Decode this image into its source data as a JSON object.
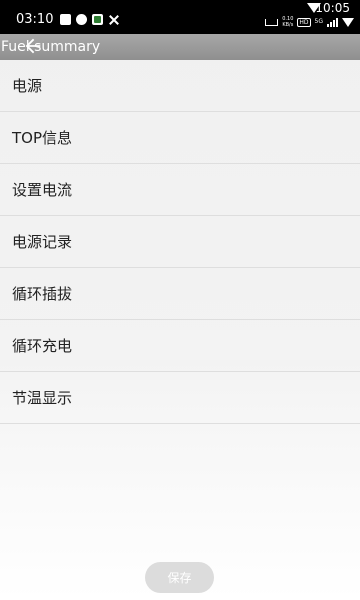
{
  "status_bar": {
    "time_left": "03:10",
    "time_right": "10:05",
    "net_speed_value": "0.10",
    "net_speed_unit": "KB/s",
    "hd_label": "HD",
    "network_label": "5G"
  },
  "app_bar": {
    "title": "Fuel summary",
    "back_icon": "arrow-left-icon"
  },
  "menu": {
    "items": [
      {
        "label": "电源"
      },
      {
        "label": "TOP信息"
      },
      {
        "label": "设置电流"
      },
      {
        "label": "电源记录"
      },
      {
        "label": "循环插拔"
      },
      {
        "label": "循环充电"
      },
      {
        "label": "节温显示"
      }
    ]
  },
  "footer": {
    "save_label": "保存"
  },
  "colors": {
    "app_bar": "#999999",
    "status_bar": "#000000",
    "background": "#f2f2f2",
    "save_button": "#dcdcdc"
  }
}
